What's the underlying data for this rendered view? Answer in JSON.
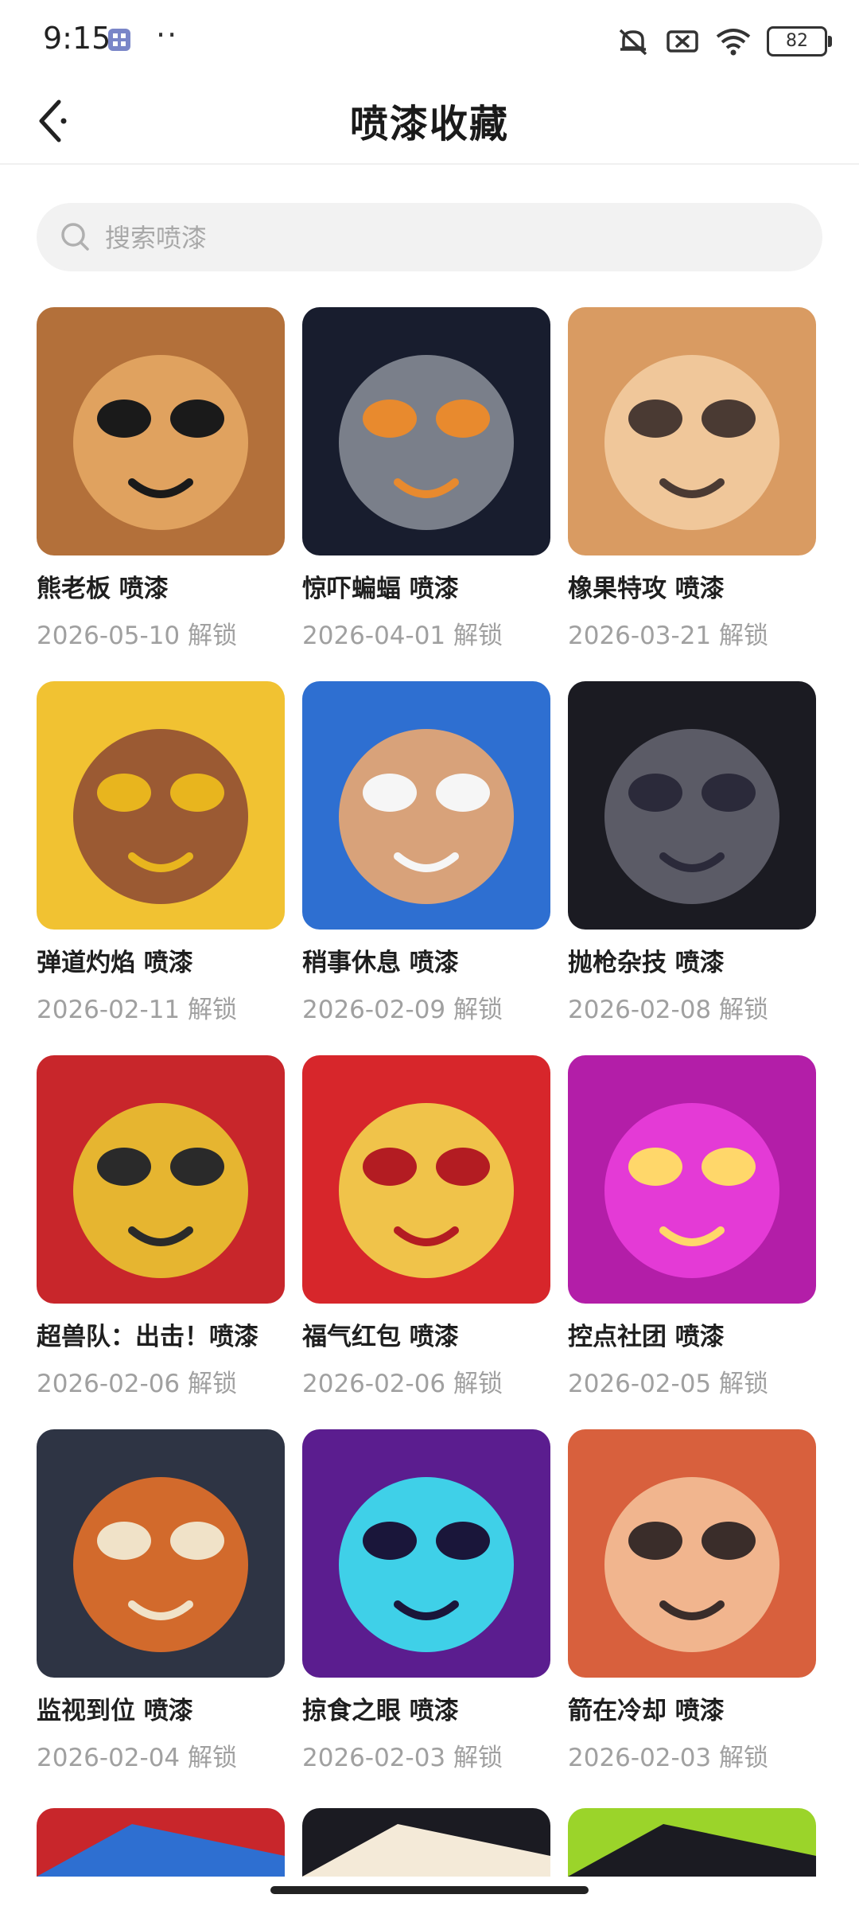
{
  "status_bar": {
    "time": "9:15",
    "dots": "··",
    "battery": "82"
  },
  "header": {
    "title": "喷漆收藏",
    "back_icon": "chevron-left-icon"
  },
  "search": {
    "placeholder": "搜索喷漆"
  },
  "items": [
    {
      "name": "熊老板 喷漆",
      "date": "2026-05-10 解锁",
      "colors": [
        "#b3703a",
        "#e0a25f",
        "#1a1a1a"
      ]
    },
    {
      "name": "惊吓蝙蝠 喷漆",
      "date": "2026-04-01 解锁",
      "colors": [
        "#181d2e",
        "#7a7f8a",
        "#e88a2e"
      ]
    },
    {
      "name": "橡果特攻 喷漆",
      "date": "2026-03-21 解锁",
      "colors": [
        "#d99b62",
        "#f0c79a",
        "#4a3a33"
      ]
    },
    {
      "name": "弹道灼焰 喷漆",
      "date": "2026-02-11 解锁",
      "colors": [
        "#f1c232",
        "#9b5a33",
        "#e8b51e"
      ]
    },
    {
      "name": "稍事休息 喷漆",
      "date": "2026-02-09 解锁",
      "colors": [
        "#2e6fd1",
        "#d8a27a",
        "#f6f6f6"
      ]
    },
    {
      "name": "抛枪杂技 喷漆",
      "date": "2026-02-08 解锁",
      "colors": [
        "#1b1b22",
        "#5b5b66",
        "#2b2a3a"
      ]
    },
    {
      "name": "超兽队：出击！喷漆",
      "date": "2026-02-06 解锁",
      "colors": [
        "#c8262b",
        "#e6b530",
        "#2a2a2a"
      ]
    },
    {
      "name": "福气红包 喷漆",
      "date": "2026-02-06 解锁",
      "colors": [
        "#d7262b",
        "#f0c34a",
        "#b31c22"
      ]
    },
    {
      "name": "控点社团 喷漆",
      "date": "2026-02-05 解锁",
      "colors": [
        "#b31ea8",
        "#e43ad6",
        "#ffd76a"
      ]
    },
    {
      "name": "监视到位 喷漆",
      "date": "2026-02-04 解锁",
      "colors": [
        "#2e3444",
        "#d26a2c",
        "#f0e2c8"
      ]
    },
    {
      "name": "掠食之眼 喷漆",
      "date": "2026-02-03 解锁",
      "colors": [
        "#5b1d8f",
        "#3fd0e8",
        "#1a163a"
      ]
    },
    {
      "name": "箭在冷却 喷漆",
      "date": "2026-02-03 解锁",
      "colors": [
        "#d8603d",
        "#f1b58e",
        "#3a2d2a"
      ]
    }
  ],
  "partial_items": [
    {
      "colors": [
        "#c8262b",
        "#2e6fd1"
      ]
    },
    {
      "colors": [
        "#1b1b22",
        "#f4ead8"
      ]
    },
    {
      "colors": [
        "#9bd42a",
        "#1b1b22"
      ]
    }
  ]
}
